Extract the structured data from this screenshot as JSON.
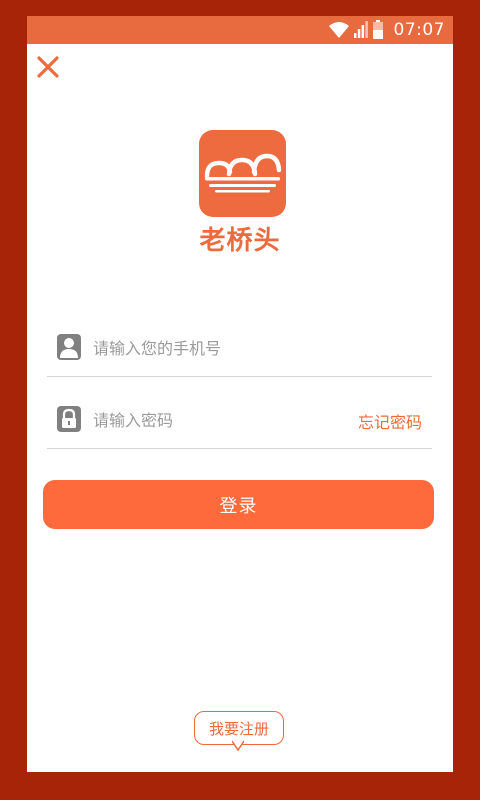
{
  "status_bar": {
    "time": "07:07",
    "icons": [
      "wifi-icon",
      "signal-icon",
      "battery-icon"
    ]
  },
  "app": {
    "name": "老桥头",
    "logo_icon": "bridge-logo-icon"
  },
  "form": {
    "phone_placeholder": "请输入您的手机号",
    "phone_value": "",
    "password_placeholder": "请输入密码",
    "password_value": "",
    "forgot_label": "忘记密码",
    "login_label": "登录"
  },
  "footer": {
    "register_label": "我要注册"
  },
  "colors": {
    "background": "#a82408",
    "accent": "#ec6b3d",
    "button": "#ff6a3c",
    "status_bar": "#e86a3f"
  }
}
